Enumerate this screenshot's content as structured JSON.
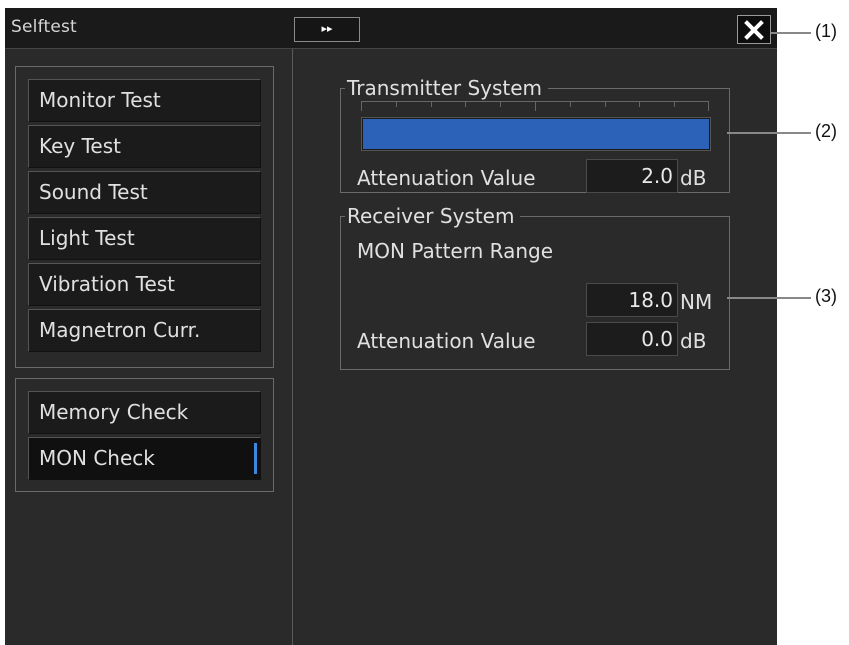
{
  "window": {
    "title": "Selftest",
    "expand_icon": "fast-forward-icon",
    "expand_glyph": "▸▸",
    "close_icon": "close-icon"
  },
  "left_panel": {
    "group1": [
      {
        "label": "Monitor Test"
      },
      {
        "label": "Key Test"
      },
      {
        "label": "Sound Test"
      },
      {
        "label": "Light Test"
      },
      {
        "label": "Vibration Test"
      },
      {
        "label": "Magnetron Curr."
      }
    ],
    "group2": [
      {
        "label": "Memory Check"
      },
      {
        "label": "MON Check",
        "selected": true
      }
    ]
  },
  "transmitter": {
    "title": "Transmitter System",
    "level_fraction": 1.0,
    "attenuation_label": "Attenuation Value",
    "attenuation_value": "2.0",
    "attenuation_unit": "dB"
  },
  "receiver": {
    "title": "Receiver System",
    "range_label": "MON Pattern Range",
    "range_value": "18.0",
    "range_unit": "NM",
    "attenuation_label": "Attenuation Value",
    "attenuation_value": "0.0",
    "attenuation_unit": "dB"
  },
  "callouts": {
    "c1": "(1)",
    "c2": "(2)",
    "c3": "(3)"
  },
  "colors": {
    "accent": "#3f86e0",
    "bar": "#2c63b8",
    "panel": "#2a2a2a"
  }
}
